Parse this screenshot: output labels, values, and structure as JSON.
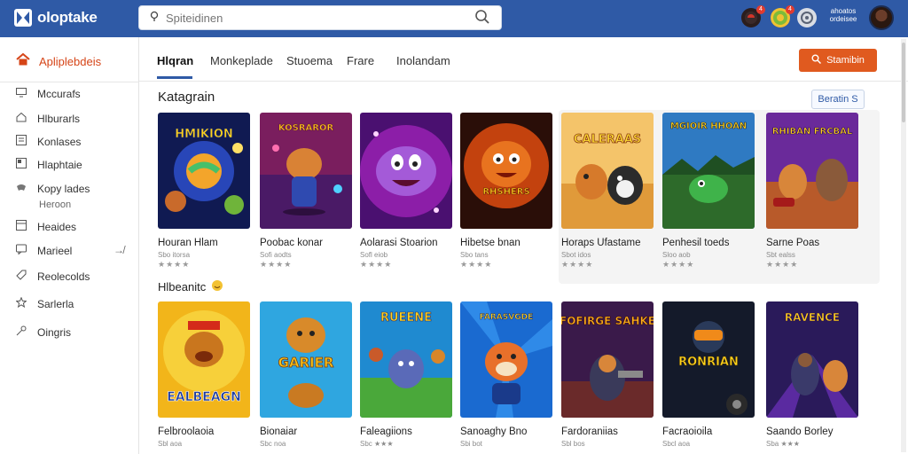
{
  "app": {
    "name": "oloptake"
  },
  "search": {
    "placeholder": "Spiteidinen"
  },
  "header": {
    "badges": [
      "4",
      "4"
    ],
    "right_label": "ahoatos ordeisee"
  },
  "sidebar": {
    "brand": "Apliplebdeis",
    "items": [
      {
        "icon": "monitor-icon",
        "label": "Mccurafs"
      },
      {
        "icon": "home-icon",
        "label": "Hlburarls"
      },
      {
        "icon": "list-icon",
        "label": "Konlases"
      },
      {
        "icon": "window-icon",
        "label": "Hlaphtaie"
      },
      {
        "icon": "controller-icon",
        "label": "Kopy lades"
      },
      {
        "icon": "frame-icon",
        "label": "Heaides"
      },
      {
        "icon": "chat-icon",
        "label": "Marieel"
      },
      {
        "icon": "tag-icon",
        "label": "Reolecolds"
      },
      {
        "icon": "star-icon",
        "label": "Sarlerla"
      },
      {
        "icon": "key-icon",
        "label": "Oingris"
      }
    ],
    "sub_label": "Heroon",
    "arrow": "↛"
  },
  "tabs": [
    "Hlqran",
    "Monkeplade",
    "Stuoema",
    "Frare",
    "Inolandam"
  ],
  "cta_label": "Stamibin",
  "section1": {
    "title": "Katagrain",
    "see_all": "Beratin S"
  },
  "section2": {
    "title": "Hlbeanitc"
  },
  "row1": [
    {
      "title": "Houran Hlam",
      "sub": "Sbo itorsa",
      "stars": "★★★★",
      "art": "HMIKION"
    },
    {
      "title": "Poobac konar",
      "sub": "Sofi aodts",
      "stars": "★★★★",
      "art": "KOSRAROR"
    },
    {
      "title": "Aolarasi Stoarion",
      "sub": "Sofl eiob",
      "stars": "★★★★",
      "art": ""
    },
    {
      "title": "Hibetse bnan",
      "sub": "Sbo tans",
      "stars": "★★★★",
      "art": "RHSHERS"
    },
    {
      "title": "Horaps Ufastame",
      "sub": "Sbot idos",
      "stars": "★★★★",
      "art": "CALERAAS"
    },
    {
      "title": "Penhesil toeds",
      "sub": "Sloo aob",
      "stars": "★★★★",
      "art": "MGIOIR HHOAN"
    },
    {
      "title": "Sarne Poas",
      "sub": "Sbt ealss",
      "stars": "★★★★",
      "art": "RHIBAN FRCBAL"
    }
  ],
  "row2": [
    {
      "title": "Felbroolaoia",
      "sub": "Sbl aoa",
      "stars": "",
      "art": "EALBEAGN"
    },
    {
      "title": "Bionaiar",
      "sub": "Sbc noa",
      "stars": "",
      "art": "GARIER"
    },
    {
      "title": "Faleagiions",
      "sub": "Sbc ★★★",
      "stars": "",
      "art": "RUEENE"
    },
    {
      "title": "Sanoaghy Bno",
      "sub": "Sbi bot",
      "stars": "",
      "art": "FARASVGDE"
    },
    {
      "title": "Fardoraniias",
      "sub": "Sbl bos",
      "stars": "",
      "art": "FOFIRGE SAHKE"
    },
    {
      "title": "Facraoioila",
      "sub": "Sbcl aoa",
      "stars": "",
      "art": "RONRIAN"
    },
    {
      "title": "Saando Borley",
      "sub": "Sba ★★★",
      "stars": "",
      "art": "RAVENCE"
    }
  ]
}
